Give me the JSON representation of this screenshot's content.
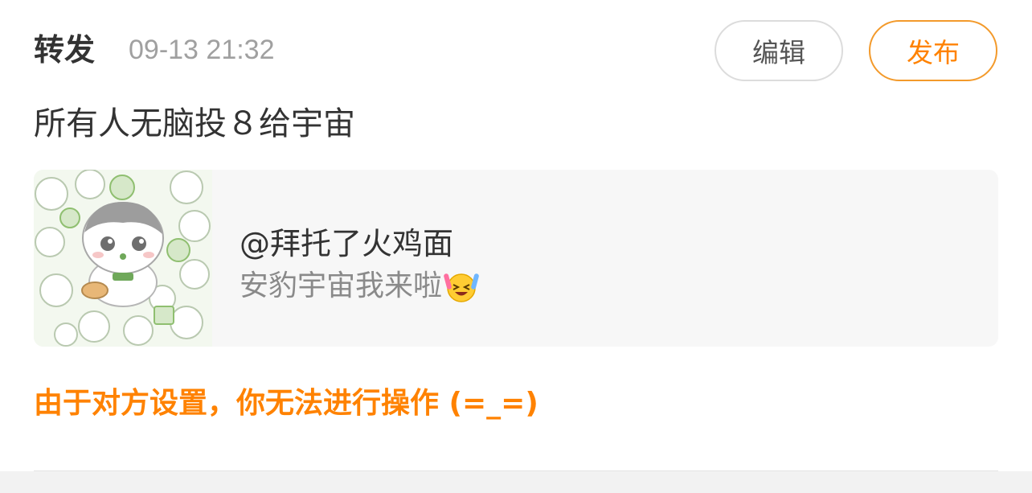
{
  "header": {
    "title": "转发",
    "timestamp": "09-13 21:32",
    "edit_label": "编辑",
    "publish_label": "发布"
  },
  "post": {
    "text": "所有人无脑投８给宇宙"
  },
  "quote": {
    "author": "@拜托了火鸡面",
    "text": "安豹宇宙我来啦",
    "emoji": "laughing-crying-emoji"
  },
  "notice": "由于对方设置，你无法进行操作 (=_=)",
  "colors": {
    "accent": "#ff8200",
    "text_primary": "#333333",
    "text_secondary": "#8a8a8a",
    "card_bg": "#f7f7f7"
  }
}
